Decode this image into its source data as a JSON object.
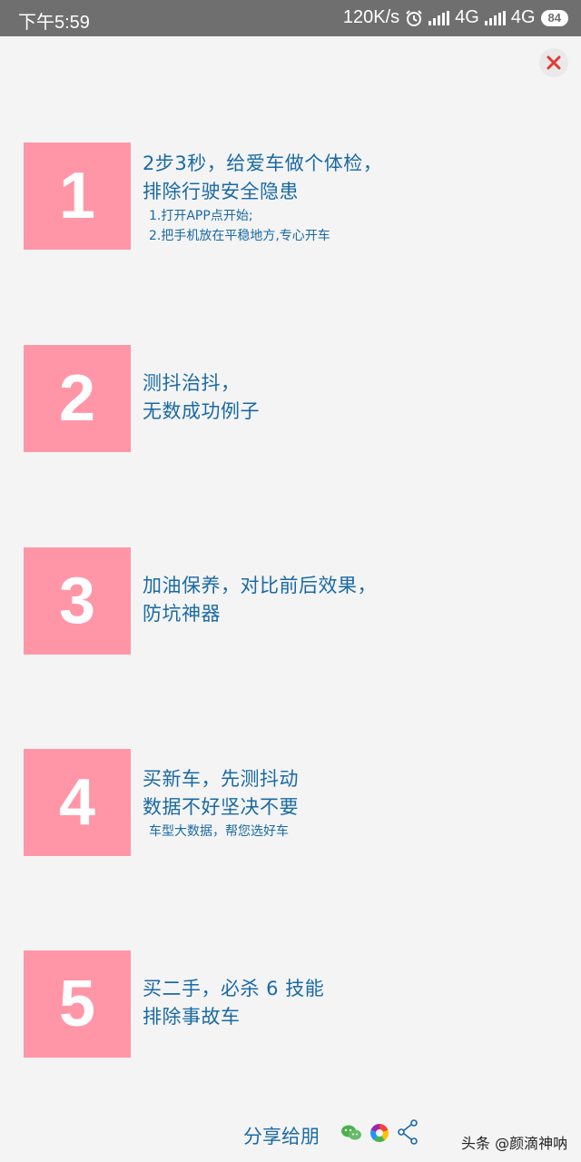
{
  "status_bar": {
    "time": "下午5:59",
    "speed": "120K/s",
    "network1": "4G",
    "network2": "4G",
    "battery": "84"
  },
  "colors": {
    "number_box": "#ff96a7",
    "text": "#1a6aa3",
    "close_x": "#e53935"
  },
  "steps": [
    {
      "number": "1",
      "line1": "2步3秒，给爱车做个体检，",
      "line2": "排除行驶安全隐患",
      "sub1": "1.打开APP点开始;",
      "sub2": "2.把手机放在平稳地方,专心开车"
    },
    {
      "number": "2",
      "line1": "测抖治抖，",
      "line2": "无数成功例子"
    },
    {
      "number": "3",
      "line1": "加油保养，对比前后效果，",
      "line2": "防坑神器"
    },
    {
      "number": "4",
      "line1": "买新车，先测抖动",
      "line2": "数据不好坚决不要",
      "sub1": "车型大数据，帮您选好车"
    },
    {
      "number": "5",
      "line1": "买二手，必杀 6 技能",
      "line2": "排除事故车"
    }
  ],
  "footer": {
    "share_label": "分享给朋",
    "icons": [
      "wechat-icon",
      "moments-icon",
      "share-icon"
    ],
    "watermark": "头条 @颜滴神呐"
  }
}
